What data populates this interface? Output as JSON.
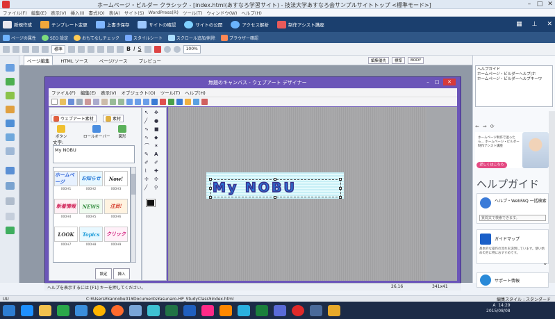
{
  "window": {
    "title": "ホームページ・ビルダー クラシック - [index.html(あすなろ学習サイト) - 技法大学あすなろ会サンプルサイトトップ <標準モード>]"
  },
  "menubar": [
    "ファイル(F)",
    "編集(E)",
    "表示(V)",
    "挿入(I)",
    "書式(O)",
    "表(A)",
    "サイト(S)",
    "WordPress(R)",
    "ツール(T)",
    "ウィンドウ(W)",
    "ヘルプ(H)"
  ],
  "ribbon": {
    "items": [
      {
        "label": "新規作成",
        "icon": "new-doc-icon",
        "color": "#e8e8f0"
      },
      {
        "label": "テンプレート変更",
        "icon": "template-icon",
        "color": "#f3a83b"
      },
      {
        "label": "上書き保存",
        "icon": "save-icon",
        "color": "#7fb6ff"
      },
      {
        "label": "サイトの確認",
        "icon": "site-check-icon",
        "color": "#9cc8ff"
      },
      {
        "label": "サイトの公開",
        "icon": "publish-icon",
        "color": "#7fd0ff"
      },
      {
        "label": "アクセス解析",
        "icon": "analytics-icon",
        "color": "#6ab4ff"
      },
      {
        "label": "制作アシスト講座",
        "icon": "assist-icon",
        "color": "#e85a5a"
      }
    ],
    "right_icons": [
      "layout-icon",
      "pin-icon",
      "close-icon"
    ]
  },
  "subribbon": [
    {
      "label": "ページの属性",
      "color": "#6fb3ff"
    },
    {
      "label": "SEO 設定",
      "color": "#7ddc7d"
    },
    {
      "label": "おもてなしチェック",
      "color": "#ffcc55"
    },
    {
      "label": "スタイルシート",
      "color": "#77aaff"
    },
    {
      "label": "スクロール追加/削除",
      "color": "#aaddff"
    },
    {
      "label": "ブラウザー確認",
      "color": "#ff8855"
    }
  ],
  "formatbar": {
    "style_select": "標準",
    "zoom": "100%",
    "bold": "B",
    "italic": "I",
    "underline": "S"
  },
  "tabs": [
    {
      "label": "ページ編集",
      "active": true
    },
    {
      "label": "HTML ソース",
      "active": false
    },
    {
      "label": "ページ/ソース",
      "active": false
    },
    {
      "label": "プレビュー",
      "active": false
    }
  ],
  "tabbar_right": {
    "edit_priority": "編集優先",
    "mode": "標準",
    "element": "BODY"
  },
  "designer": {
    "title": "無題のキャンバス - ウェブアート デザイナー",
    "menu": [
      "ファイル(F)",
      "編集(E)",
      "表示(V)",
      "オブジェクト(O)",
      "ツール(T)",
      "ヘルプ(H)"
    ],
    "close_label": "✕",
    "min_label": "–",
    "max_label": "□"
  },
  "wizard": {
    "tab1": "ウェブアート素材",
    "tab2": "素材",
    "cat_button": "ボタン",
    "cat_logo": "ロールオーバー",
    "cat_image": "図形",
    "text_label": "文字:",
    "text_value": "My NOBU",
    "swatches": [
      {
        "text": "ホームページ",
        "num": "000H1",
        "color": "#2a5fd6",
        "bg": "#e7f1ff"
      },
      {
        "text": "お知らせ",
        "num": "000H2",
        "color": "#2b7dd8",
        "bg": "#e7f7ff"
      },
      {
        "text": "Now!",
        "num": "000H3",
        "color": "#222222",
        "bg": "#ffffff"
      },
      {
        "text": "新着情報",
        "num": "000H4",
        "color": "#d0245a",
        "bg": "#fff0f5"
      },
      {
        "text": "NEWS",
        "num": "000H5",
        "color": "#2e8a3a",
        "bg": "#eefaee"
      },
      {
        "text": "注目!",
        "num": "000H6",
        "color": "#d43a2a",
        "bg": "#fff3e0"
      },
      {
        "text": "LOOK",
        "num": "000H7",
        "color": "#333333",
        "bg": "#ffffff"
      },
      {
        "text": "Topics",
        "num": "000H8",
        "color": "#1a9ad8",
        "bg": "#e8f8ff"
      },
      {
        "text": "クリック",
        "num": "000H9",
        "color": "#d01a7a",
        "bg": "#fff0f8"
      }
    ],
    "btn_set": "設定",
    "btn_insert": "挿入"
  },
  "canvas": {
    "banner_text": "My NOBU",
    "coord": "26,16",
    "size": "341x41"
  },
  "help_hint": "ヘルプを表示するには [F1] キーを押してください。",
  "right_panel": {
    "tree": [
      "ヘルプガイド",
      "ホームページ・ビルダーヘルプ(ホ",
      "ホームページ・ビルダーヘルプキーワ"
    ],
    "ad_text": "ホームページ制作で迷ったら… ホームページ・ビルダー 制作アシスト講座",
    "ad_button": "詳しくはこちら",
    "help_title": "ヘルプガイド",
    "cards": [
      {
        "title": "ヘルプ・WebFAQ 一括検索",
        "desc": "",
        "icon_color": "#3b7bd8"
      },
      {
        "title": "ガイドマップ",
        "desc": "基本的な操作の流れを説明しています。使い始めの方に特におすすめです。",
        "icon_color": "#1a5fc8"
      },
      {
        "title": "サポート情報",
        "desc": "",
        "icon_color": "#2a8ad8"
      }
    ],
    "search_placeholder": "質問文で検索できます。"
  },
  "statusbar": {
    "left": "UU",
    "path": "C:¥Users¥kannobu01¥Documents¥asunaro-HP_StudyClass¥index.html",
    "style": "編集スタイル : スタンダード"
  },
  "taskbar": {
    "time": "14:29",
    "date": "2015/08/08",
    "ime": "A"
  }
}
